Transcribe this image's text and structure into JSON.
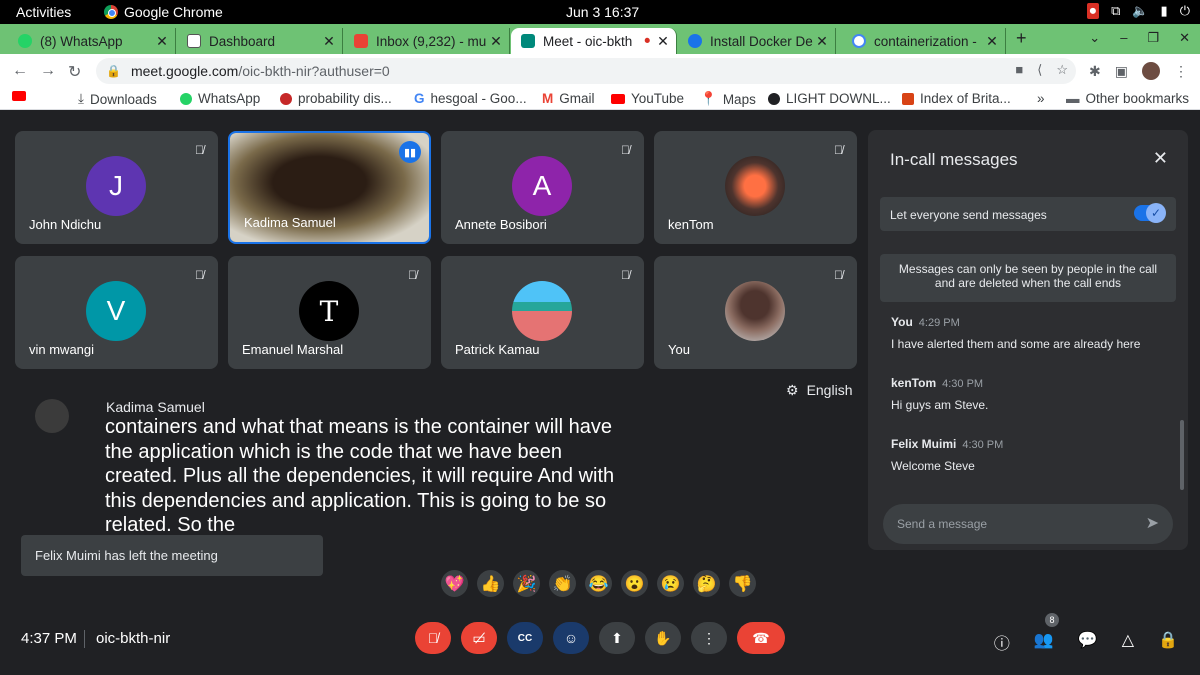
{
  "system": {
    "activities": "Activities",
    "app_name": "Google Chrome",
    "clock": "Jun 3  16:37"
  },
  "tabs": [
    {
      "title": "(8) WhatsApp",
      "color": "#25d366"
    },
    {
      "title": "Dashboard",
      "color": "#ffffff"
    },
    {
      "title": "Inbox (9,232) - mu",
      "color": "#ea4335"
    },
    {
      "title": "Meet - oic-bkth",
      "color": "#00897b"
    },
    {
      "title": "Install Docker Des",
      "color": "#1a73e8"
    },
    {
      "title": "containerization -",
      "color": "#4285f4"
    }
  ],
  "address": {
    "domain": "meet.google.com",
    "path": "/oic-bkth-nir?authuser=0"
  },
  "bookmarks": [
    {
      "label": "Downloads",
      "color": "#ffffff"
    },
    {
      "label": "WhatsApp",
      "color": "#25d366"
    },
    {
      "label": "probability dis...",
      "color": "#c62828"
    },
    {
      "label": "hesgoal - Goo...",
      "color": "#4285f4"
    },
    {
      "label": "Gmail",
      "color": "#ea4335"
    },
    {
      "label": "YouTube",
      "color": "#ff0000"
    },
    {
      "label": "Maps",
      "color": "#34a853"
    },
    {
      "label": "LIGHT DOWNL...",
      "color": "#202124"
    },
    {
      "label": "Index of Brita...",
      "color": "#d84315"
    },
    {
      "label": "»",
      "color": "#ffffff"
    },
    {
      "label": "Other bookmarks",
      "color": "#5f6368"
    }
  ],
  "participants": [
    {
      "name": "John Ndichu",
      "initial": "J",
      "avatar_color": "#5e35b1"
    },
    {
      "name": "Kadima Samuel",
      "initial": "",
      "avatar_color": "#000000"
    },
    {
      "name": "Annete Bosibori",
      "initial": "A",
      "avatar_color": "#8e24aa"
    },
    {
      "name": "kenTom",
      "initial": "",
      "avatar_color": "#4e342e"
    },
    {
      "name": "vin mwangi",
      "initial": "V",
      "avatar_color": "#0097a7"
    },
    {
      "name": "Emanuel Marshal",
      "initial": "T",
      "avatar_color": "#000000"
    },
    {
      "name": "Patrick Kamau",
      "initial": "",
      "avatar_color": "#e57373"
    },
    {
      "name": "You",
      "initial": "",
      "avatar_color": "#6d4c41"
    }
  ],
  "captions": {
    "speaker": "Kadima Samuel",
    "text": "containers and what that means is the container will have the application which is the code that we have been created. Plus all the dependencies, it will require And with this dependencies and application. This is going to be so related. So the",
    "language": "English"
  },
  "toast": "Felix Muimi has left the meeting",
  "reactions": [
    "💖",
    "👍",
    "🎉",
    "👏",
    "😂",
    "😮",
    "😢",
    "🤔",
    "👎"
  ],
  "meeting": {
    "time": "4:37 PM",
    "code": "oic-bkth-nir",
    "people_count": "8"
  },
  "chat": {
    "title": "In-call messages",
    "toggle_label": "Let everyone send messages",
    "notice": "Messages can only be seen by people in the call and are deleted when the call ends",
    "messages": [
      {
        "sender": "You",
        "time": "4:29 PM",
        "body": "I have alerted them and some are already here"
      },
      {
        "sender": "kenTom",
        "time": "4:30 PM",
        "body": "Hi guys am Steve."
      },
      {
        "sender": "Felix Muimi",
        "time": "4:30 PM",
        "body": "Welcome Steve"
      }
    ],
    "placeholder": "Send a message"
  }
}
